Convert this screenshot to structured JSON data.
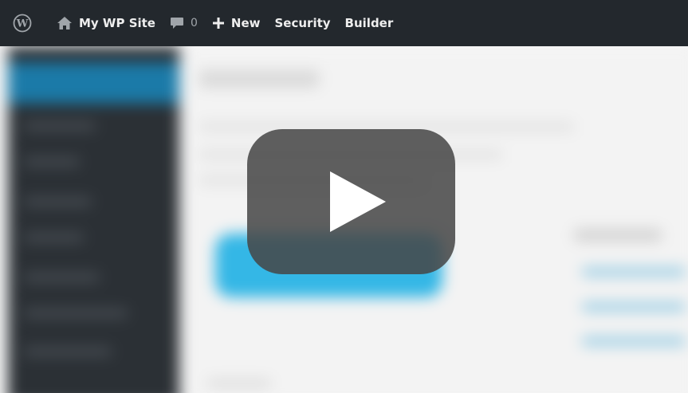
{
  "adminbar": {
    "wp_logo_icon": "wordpress-logo-icon",
    "site": {
      "icon": "home-icon",
      "label": "My WP Site"
    },
    "comments": {
      "icon": "comment-bubble-icon",
      "count": "0"
    },
    "new": {
      "icon": "plus-icon",
      "label": "New"
    },
    "security": {
      "label": "Security"
    },
    "builder": {
      "label": "Builder"
    }
  },
  "video": {
    "play_icon": "play-icon",
    "colors": {
      "adminbar": "#23282d",
      "play_button": "#464646",
      "accent": "#34b7e6"
    }
  }
}
